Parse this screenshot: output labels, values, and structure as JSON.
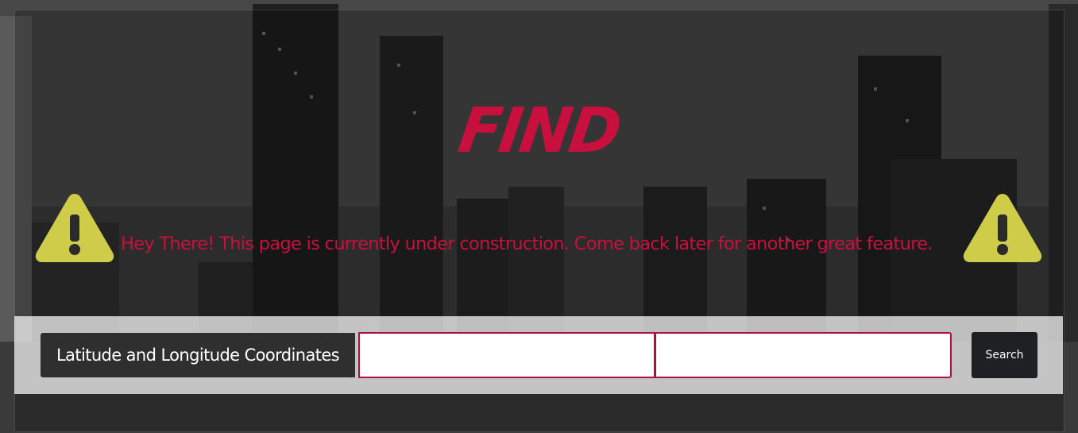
{
  "page": {
    "title": "FIND",
    "accent_color": "#c8103e",
    "warning_color": "#cfcc4a"
  },
  "notice": {
    "text": "Hey There! This page is currently under construction. Come back later for another great feature.",
    "icon": "warning-triangle-icon"
  },
  "search": {
    "label": "Latitude and Longitude Coordinates",
    "latitude_value": "",
    "latitude_placeholder": "",
    "longitude_value": "",
    "longitude_placeholder": "",
    "button_label": "Search"
  }
}
